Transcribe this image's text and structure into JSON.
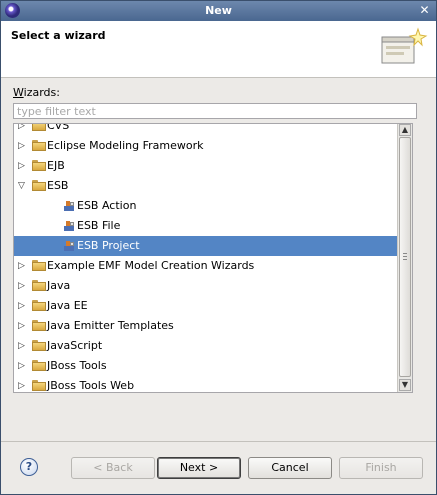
{
  "window": {
    "title": "New"
  },
  "banner": {
    "heading": "Select a wizard"
  },
  "wizards": {
    "label_accel": "W",
    "label_rest": "izards:",
    "filter_placeholder": "type filter text"
  },
  "tree": [
    {
      "label": "CVS",
      "icon": "folder-icon",
      "level": 0,
      "expander": "collapsed"
    },
    {
      "label": "Eclipse Modeling Framework",
      "icon": "folder-icon",
      "level": 0,
      "expander": "collapsed"
    },
    {
      "label": "EJB",
      "icon": "folder-icon",
      "level": 0,
      "expander": "collapsed"
    },
    {
      "label": "ESB",
      "icon": "folder-icon",
      "level": 0,
      "expander": "expanded"
    },
    {
      "label": "ESB Action",
      "icon": "esb-icon",
      "level": 1,
      "expander": "none"
    },
    {
      "label": "ESB File",
      "icon": "esb-icon",
      "level": 1,
      "expander": "none"
    },
    {
      "label": "ESB Project",
      "icon": "esb-icon",
      "level": 1,
      "expander": "none",
      "selected": true
    },
    {
      "label": "Example EMF Model Creation Wizards",
      "icon": "folder-icon",
      "level": 0,
      "expander": "collapsed"
    },
    {
      "label": "Java",
      "icon": "folder-icon",
      "level": 0,
      "expander": "collapsed"
    },
    {
      "label": "Java EE",
      "icon": "folder-icon",
      "level": 0,
      "expander": "collapsed"
    },
    {
      "label": "Java Emitter Templates",
      "icon": "folder-icon",
      "level": 0,
      "expander": "collapsed"
    },
    {
      "label": "JavaScript",
      "icon": "folder-icon",
      "level": 0,
      "expander": "collapsed"
    },
    {
      "label": "JBoss Tools",
      "icon": "folder-icon",
      "level": 0,
      "expander": "collapsed"
    },
    {
      "label": "JBoss Tools Web",
      "icon": "folder-icon",
      "level": 0,
      "expander": "collapsed"
    }
  ],
  "buttons": {
    "help": "?",
    "back": "< Back",
    "next": "Next >",
    "cancel": "Cancel",
    "finish": "Finish"
  },
  "colors": {
    "selection": "#5385c5",
    "titlebar": "#5a76a0"
  }
}
